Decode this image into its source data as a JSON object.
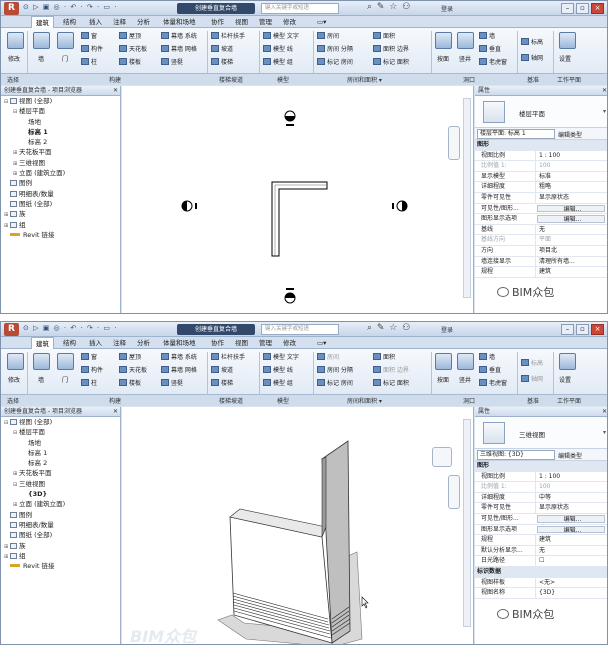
{
  "top": {
    "quick_access": "⊙ ▷ ▣ ◎ · ↶ · ↷ · ▭ ·",
    "title": "创建垂直复合墙",
    "search_placeholder": "键入关键字或短语",
    "login": "登录",
    "tabs": [
      "建筑",
      "结构",
      "插入",
      "注释",
      "分析",
      "体量和场地",
      "协作",
      "视图",
      "管理",
      "修改",
      "▭▾"
    ],
    "ribbon": {
      "modify": "修改",
      "wall": "墙",
      "door": "门",
      "window": "窗",
      "component": "构件",
      "column": "柱",
      "roof": "屋顶",
      "ceiling": "天花板",
      "floor": "楼板",
      "curtain_system": "幕墙 系统",
      "curtain_grid": "幕墙 网格",
      "mullion": "竖梃",
      "railing": "栏杆扶手",
      "ramp": "坡道",
      "stair": "楼梯",
      "model_text": "模型 文字",
      "model_line": "模型 线",
      "model_group": "模型 组",
      "room": "房间",
      "room_separator": "房间 分隔",
      "tag_room": "标记 房间",
      "area": "面积",
      "area_boundary": "面积 边界",
      "tag_area": "标记 面积",
      "by_face": "按面",
      "shaft": "竖井",
      "wall_opening": "墙",
      "vertical": "垂直",
      "dormer": "老虎窗",
      "level": "标高",
      "grid": "轴网",
      "set": "设置",
      "datum_label": "基准",
      "workplane_label": "工作平面"
    },
    "panels": [
      "选择",
      "构建",
      "楼梯坡道",
      "模型",
      "房间和面积 ▾",
      "洞口",
      "基准",
      "工作平面"
    ],
    "browser_title": "创建垂直复合墙 - 项目浏览器",
    "tree": [
      {
        "label": "视图 (全部)",
        "exp": "⊟",
        "indent": 0,
        "folder": true
      },
      {
        "label": "楼层平面",
        "exp": "⊟",
        "indent": 1,
        "folder": false
      },
      {
        "label": "场地",
        "exp": "",
        "indent": 2,
        "folder": false
      },
      {
        "label": "标高 1",
        "exp": "",
        "indent": 2,
        "folder": false,
        "bold": true
      },
      {
        "label": "标高 2",
        "exp": "",
        "indent": 2,
        "folder": false
      },
      {
        "label": "天花板平面",
        "exp": "⊞",
        "indent": 1,
        "folder": false
      },
      {
        "label": "三维视图",
        "exp": "⊞",
        "indent": 1,
        "folder": false
      },
      {
        "label": "立面 (建筑立面)",
        "exp": "⊞",
        "indent": 1,
        "folder": false
      },
      {
        "label": "图例",
        "exp": "",
        "indent": 0,
        "folder": true
      },
      {
        "label": "明细表/数量",
        "exp": "",
        "indent": 0,
        "folder": true
      },
      {
        "label": "图纸 (全部)",
        "exp": "",
        "indent": 0,
        "folder": true
      },
      {
        "label": "族",
        "exp": "⊞",
        "indent": 0,
        "folder": true
      },
      {
        "label": "组",
        "exp": "⊞",
        "indent": 0,
        "folder": true
      },
      {
        "label": "Revit 链接",
        "exp": "",
        "indent": 0,
        "link": true
      }
    ],
    "props_title": "属性",
    "type_name": "楼层平面",
    "filter": "楼层平面: 标高 1",
    "edit_type": "编辑类型",
    "group": "图形",
    "props": [
      {
        "k": "视图比例",
        "v": "1 : 100"
      },
      {
        "k": "比例值 1:",
        "v": "100",
        "gray": true
      },
      {
        "k": "显示模型",
        "v": "标准"
      },
      {
        "k": "详细程度",
        "v": "粗略"
      },
      {
        "k": "零件可见性",
        "v": "显示原状态"
      },
      {
        "k": "可见性/图形...",
        "v": "编辑...",
        "btn": true
      },
      {
        "k": "图形显示选项",
        "v": "编辑...",
        "btn": true
      },
      {
        "k": "基线",
        "v": "无"
      },
      {
        "k": "基线方向",
        "v": "平面",
        "gray": true
      },
      {
        "k": "方向",
        "v": "项目北"
      },
      {
        "k": "墙连接显示",
        "v": "清理所有墙..."
      },
      {
        "k": "规程",
        "v": "建筑"
      }
    ],
    "watermark": "BIM众包"
  },
  "bottom": {
    "quick_access": "⊙ ▷ ▣ ◎ · ↶ · ↷ · ▭ ·",
    "title": "创建垂直复合墙",
    "search_placeholder": "键入关键字或短语",
    "login": "登录",
    "tabs": [
      "建筑",
      "结构",
      "插入",
      "注释",
      "分析",
      "体量和场地",
      "协作",
      "视图",
      "管理",
      "修改",
      "▭▾"
    ],
    "browser_title": "创建垂直复合墙 - 项目浏览器",
    "tree": [
      {
        "label": "视图 (全部)",
        "exp": "⊟",
        "indent": 0,
        "folder": true
      },
      {
        "label": "楼层平面",
        "exp": "⊟",
        "indent": 1,
        "folder": false
      },
      {
        "label": "场地",
        "exp": "",
        "indent": 2,
        "folder": false
      },
      {
        "label": "标高 1",
        "exp": "",
        "indent": 2,
        "folder": false
      },
      {
        "label": "标高 2",
        "exp": "",
        "indent": 2,
        "folder": false
      },
      {
        "label": "天花板平面",
        "exp": "⊞",
        "indent": 1,
        "folder": false
      },
      {
        "label": "三维视图",
        "exp": "⊟",
        "indent": 1,
        "folder": false
      },
      {
        "label": "{3D}",
        "exp": "",
        "indent": 2,
        "folder": false,
        "bold": true
      },
      {
        "label": "立面 (建筑立面)",
        "exp": "⊞",
        "indent": 1,
        "folder": false
      },
      {
        "label": "图例",
        "exp": "",
        "indent": 0,
        "folder": true
      },
      {
        "label": "明细表/数量",
        "exp": "",
        "indent": 0,
        "folder": true
      },
      {
        "label": "图纸 (全部)",
        "exp": "",
        "indent": 0,
        "folder": true
      },
      {
        "label": "族",
        "exp": "⊞",
        "indent": 0,
        "folder": true
      },
      {
        "label": "组",
        "exp": "⊞",
        "indent": 0,
        "folder": true
      },
      {
        "label": "Revit 链接",
        "exp": "",
        "indent": 0,
        "link": true
      }
    ],
    "props_title": "属性",
    "type_name": "三维视图",
    "filter": "三维视图: {3D}",
    "edit_type": "编辑类型",
    "group": "图形",
    "props": [
      {
        "k": "视图比例",
        "v": "1 : 100"
      },
      {
        "k": "比例值 1:",
        "v": "100",
        "gray": true
      },
      {
        "k": "详细程度",
        "v": "中等"
      },
      {
        "k": "零件可见性",
        "v": "显示原状态"
      },
      {
        "k": "可见性/图形...",
        "v": "编辑...",
        "btn": true
      },
      {
        "k": "图形显示选项",
        "v": "编辑...",
        "btn": true
      },
      {
        "k": "规程",
        "v": "建筑"
      },
      {
        "k": "默认分析显示...",
        "v": "无"
      },
      {
        "k": "日光路径",
        "v": "☐"
      },
      {
        "k": "标识数据",
        "v": "",
        "group": true
      },
      {
        "k": "视图样板",
        "v": "<无>"
      },
      {
        "k": "视图名称",
        "v": "{3D}"
      }
    ],
    "watermark": "BIM众包",
    "bg_watermark": "BIM众包"
  },
  "colors": {
    "ribbon": "#dde7f3",
    "accent": "#33496b",
    "close": "#c9483a"
  }
}
